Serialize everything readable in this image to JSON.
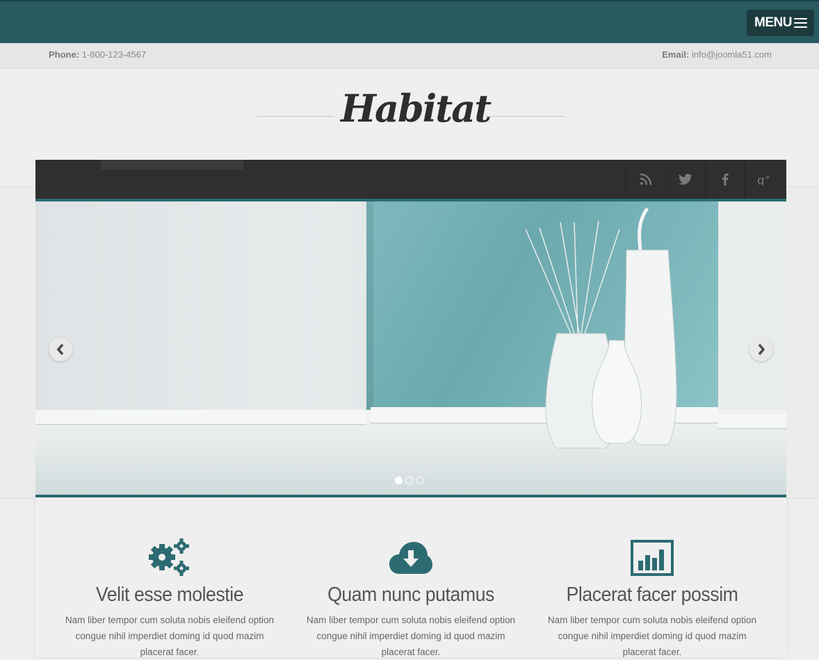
{
  "header": {
    "menu_label": "MENU",
    "phone_label": "Phone:",
    "phone_value": "1-800-123-4567",
    "email_label": "Email:",
    "email_value": "info@joomla51.com"
  },
  "brand": {
    "logo_text": "Habitat"
  },
  "colors": {
    "accent": "#2d6b72",
    "topbar": "#285a60",
    "dark_bar": "#2f2f2f"
  },
  "social": [
    {
      "name": "rss-icon"
    },
    {
      "name": "twitter-icon"
    },
    {
      "name": "facebook-icon"
    },
    {
      "name": "google-plus-icon"
    }
  ],
  "slider": {
    "slide_count": 3,
    "active_slide": 1
  },
  "features": [
    {
      "icon": "gears-icon",
      "title": "Velit esse molestie",
      "text": "Nam liber tempor cum soluta nobis eleifend option congue nihil imperdiet doming id quod mazim placerat facer."
    },
    {
      "icon": "cloud-download-icon",
      "title": "Quam nunc putamus",
      "text": "Nam liber tempor cum soluta nobis eleifend option congue nihil imperdiet doming id quod mazim placerat facer."
    },
    {
      "icon": "bar-chart-icon",
      "title": "Placerat facer possim",
      "text": "Nam liber tempor cum soluta nobis eleifend option congue nihil imperdiet doming id quod mazim placerat facer."
    }
  ]
}
